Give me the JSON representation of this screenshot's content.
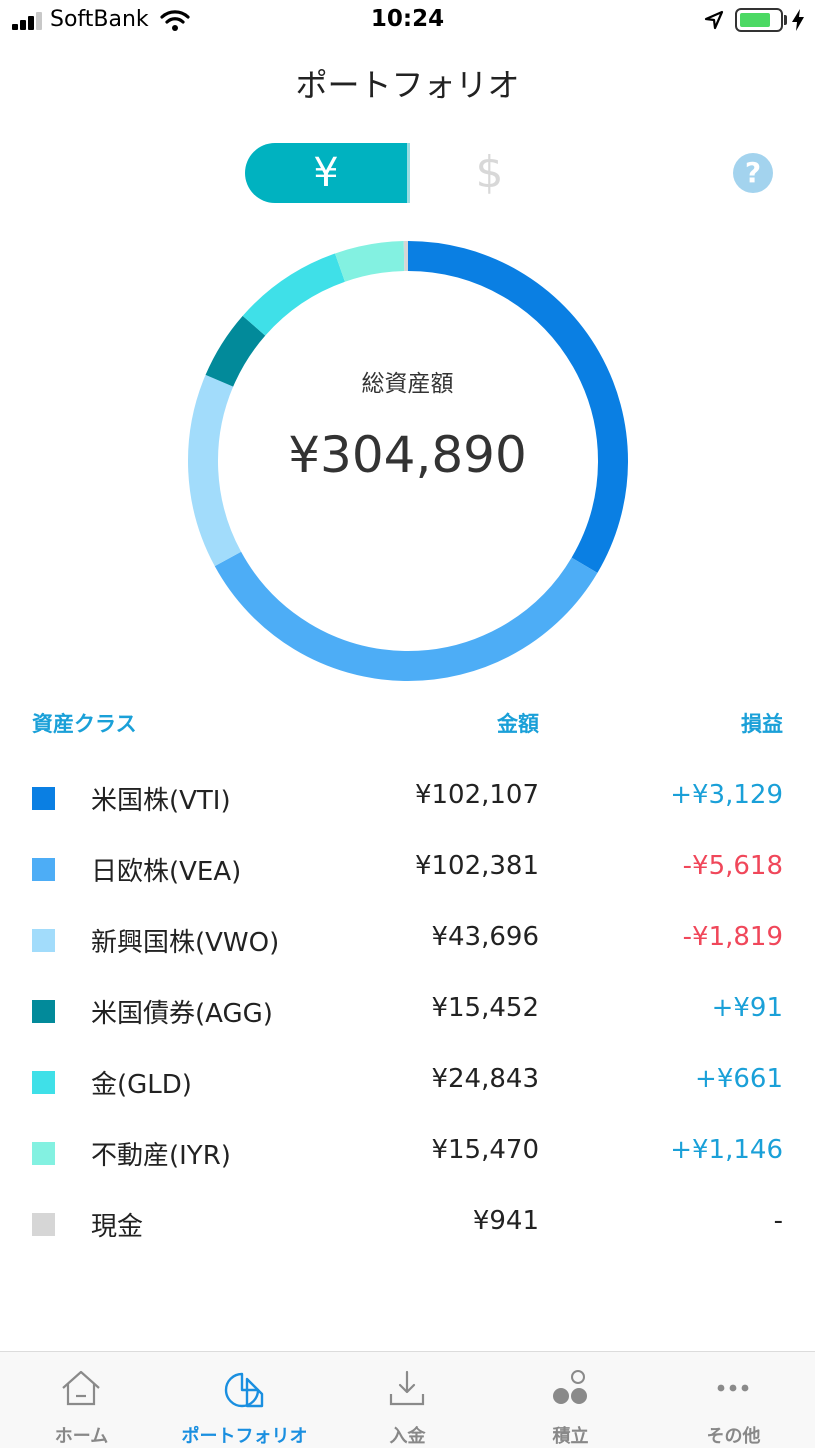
{
  "status_bar": {
    "carrier": "SoftBank",
    "time": "10:24",
    "battery_level": 0.75,
    "battery_color": "#4cd964"
  },
  "header": {
    "title": "ポートフォリオ"
  },
  "currency_toggle": {
    "yen_label": "¥",
    "usd_label": "$",
    "selected": "¥",
    "active_color": "#00b2c0"
  },
  "help": {
    "label": "?",
    "icon": "question-mark-icon"
  },
  "summary": {
    "total_label": "総資産額",
    "total_value": "¥304,890"
  },
  "table": {
    "headers": {
      "asset_class": "資産クラス",
      "amount": "金額",
      "profit": "損益"
    },
    "header_color": "#1aa0d8",
    "rows": [
      {
        "name": "米国株(VTI)",
        "amount": "¥102,107",
        "profit": "+¥3,129",
        "value": 102107,
        "color": "#0a7fe3",
        "profit_color": "#1aa0d8"
      },
      {
        "name": "日欧株(VEA)",
        "amount": "¥102,381",
        "profit": "-¥5,618",
        "value": 102381,
        "color": "#4dadf6",
        "profit_color": "#f0475a"
      },
      {
        "name": "新興国株(VWO)",
        "amount": "¥43,696",
        "profit": "-¥1,819",
        "value": 43696,
        "color": "#a2dcfb",
        "profit_color": "#f0475a"
      },
      {
        "name": "米国債券(AGG)",
        "amount": "¥15,452",
        "profit": "+¥91",
        "value": 15452,
        "color": "#028a9a",
        "profit_color": "#1aa0d8"
      },
      {
        "name": "金(GLD)",
        "amount": "¥24,843",
        "profit": "+¥661",
        "value": 24843,
        "color": "#3fe0e8",
        "profit_color": "#1aa0d8"
      },
      {
        "name": "不動産(IYR)",
        "amount": "¥15,470",
        "profit": "+¥1,146",
        "value": 15470,
        "color": "#83f1e1",
        "profit_color": "#1aa0d8"
      },
      {
        "name": "現金",
        "amount": "¥941",
        "profit": "-",
        "value": 941,
        "color": "#d6d6d6",
        "profit_color": "#222222"
      }
    ]
  },
  "tabbar": {
    "active_color": "#1a8fe0",
    "tabs": [
      {
        "label": "ホーム",
        "icon": "home-icon"
      },
      {
        "label": "ポートフォリオ",
        "icon": "pie-chart-icon"
      },
      {
        "label": "入金",
        "icon": "deposit-icon"
      },
      {
        "label": "積立",
        "icon": "savings-icon"
      },
      {
        "label": "その他",
        "icon": "more-icon"
      }
    ],
    "active_tab": "ポートフォリオ"
  }
}
